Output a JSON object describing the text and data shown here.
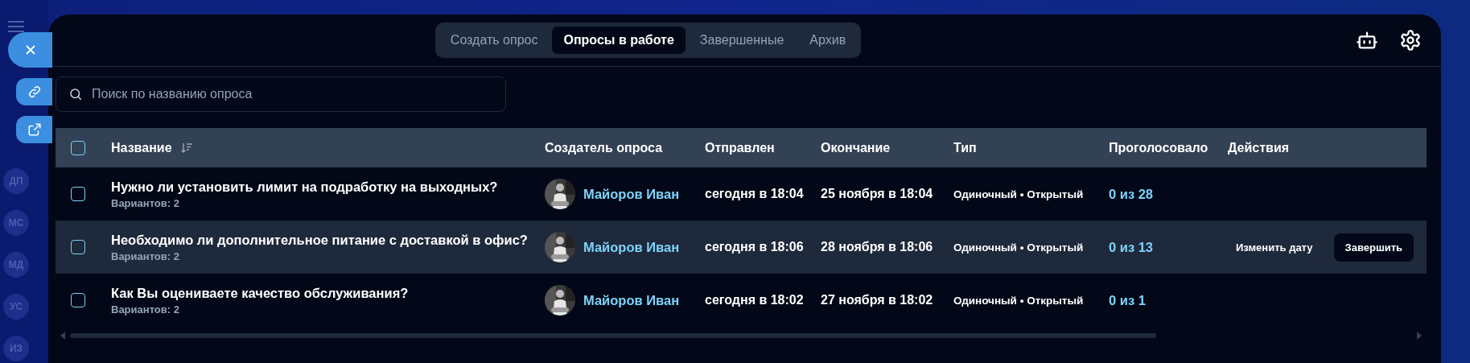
{
  "background": {
    "sidebar_avatars": [
      "ДП",
      "МС",
      "МД",
      "УС",
      "ИЗ"
    ]
  },
  "side_actions": [
    {
      "kind": "close"
    },
    {
      "kind": "link"
    },
    {
      "kind": "external"
    }
  ],
  "tabs": [
    {
      "label": "Создать опрос",
      "selected": false
    },
    {
      "label": "Опросы в работе",
      "selected": true
    },
    {
      "label": "Завершенные",
      "selected": false
    },
    {
      "label": "Архив",
      "selected": false
    }
  ],
  "search": {
    "placeholder": "Поиск по названию опроса"
  },
  "table": {
    "select_all": {
      "checked": false
    },
    "columns": [
      {
        "label": "Название",
        "sorted": true
      },
      {
        "label": "Создатель опроса",
        "sorted": false
      },
      {
        "label": "Отправлен",
        "sorted": false
      },
      {
        "label": "Окончание",
        "sorted": false
      },
      {
        "label": "Тип",
        "sorted": false
      },
      {
        "label": "Проголосовало",
        "sorted": false
      },
      {
        "label": "Действия",
        "sorted": false
      }
    ],
    "rows": [
      {
        "checked": false,
        "highlighted": false,
        "title": "Нужно ли установить лимит на подработку на выходных?",
        "variants": "Вариантов: 2",
        "creator": "Майоров Иван",
        "sent": "сегодня в 18:04",
        "ends": "25 ноября в 18:04",
        "type": "Одиночный • Открытый",
        "voted": "0 из 28",
        "actions": []
      },
      {
        "checked": false,
        "highlighted": true,
        "title": "Необходимо ли дополнительное питание с доставкой в офис?",
        "variants": "Вариантов: 2",
        "creator": "Майоров Иван",
        "sent": "сегодня в 18:06",
        "ends": "28 ноября в 18:06",
        "type": "Одиночный • Открытый",
        "voted": "0 из 13",
        "actions": [
          {
            "label": "Изменить дату",
            "kind": "plain"
          },
          {
            "label": "Завершить",
            "kind": "primary"
          }
        ]
      },
      {
        "checked": false,
        "highlighted": false,
        "title": "Как Вы оцениваете качество обслуживания?",
        "variants": "Вариантов: 2",
        "creator": "Майоров Иван",
        "sent": "сегодня в 18:02",
        "ends": "27 ноября в 18:02",
        "type": "Одиночный • Открытый",
        "voted": "0 из 1",
        "actions": []
      }
    ]
  }
}
